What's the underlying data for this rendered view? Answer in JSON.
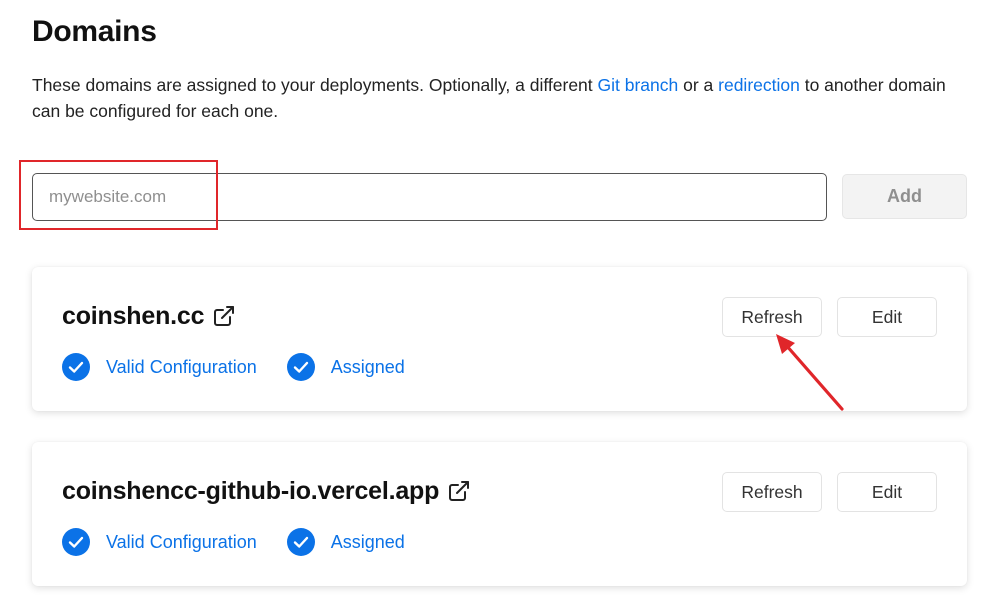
{
  "page": {
    "title": "Domains",
    "description": {
      "part1": "These domains are assigned to your deployments. Optionally, a different ",
      "link1": "Git branch",
      "part2": " or a ",
      "link2": "redirection",
      "part3": " to another domain can be configured for each one."
    }
  },
  "add_domain": {
    "input_value": "",
    "placeholder": "mywebsite.com",
    "button_label": "Add"
  },
  "domains": [
    {
      "name": "coinshen.cc",
      "statuses": [
        "Valid Configuration",
        "Assigned"
      ],
      "refresh_label": "Refresh",
      "edit_label": "Edit"
    },
    {
      "name": "coinshencc-github-io.vercel.app",
      "statuses": [
        "Valid Configuration",
        "Assigned"
      ],
      "refresh_label": "Refresh",
      "edit_label": "Edit"
    }
  ],
  "icons": {
    "external": "external-link-icon",
    "status": "check-circle-icon"
  },
  "colors": {
    "link": "#0b72e7",
    "status_check": "#0b72e7",
    "annotation": "#e0262a",
    "disabled_button_bg": "#f3f3f3"
  }
}
